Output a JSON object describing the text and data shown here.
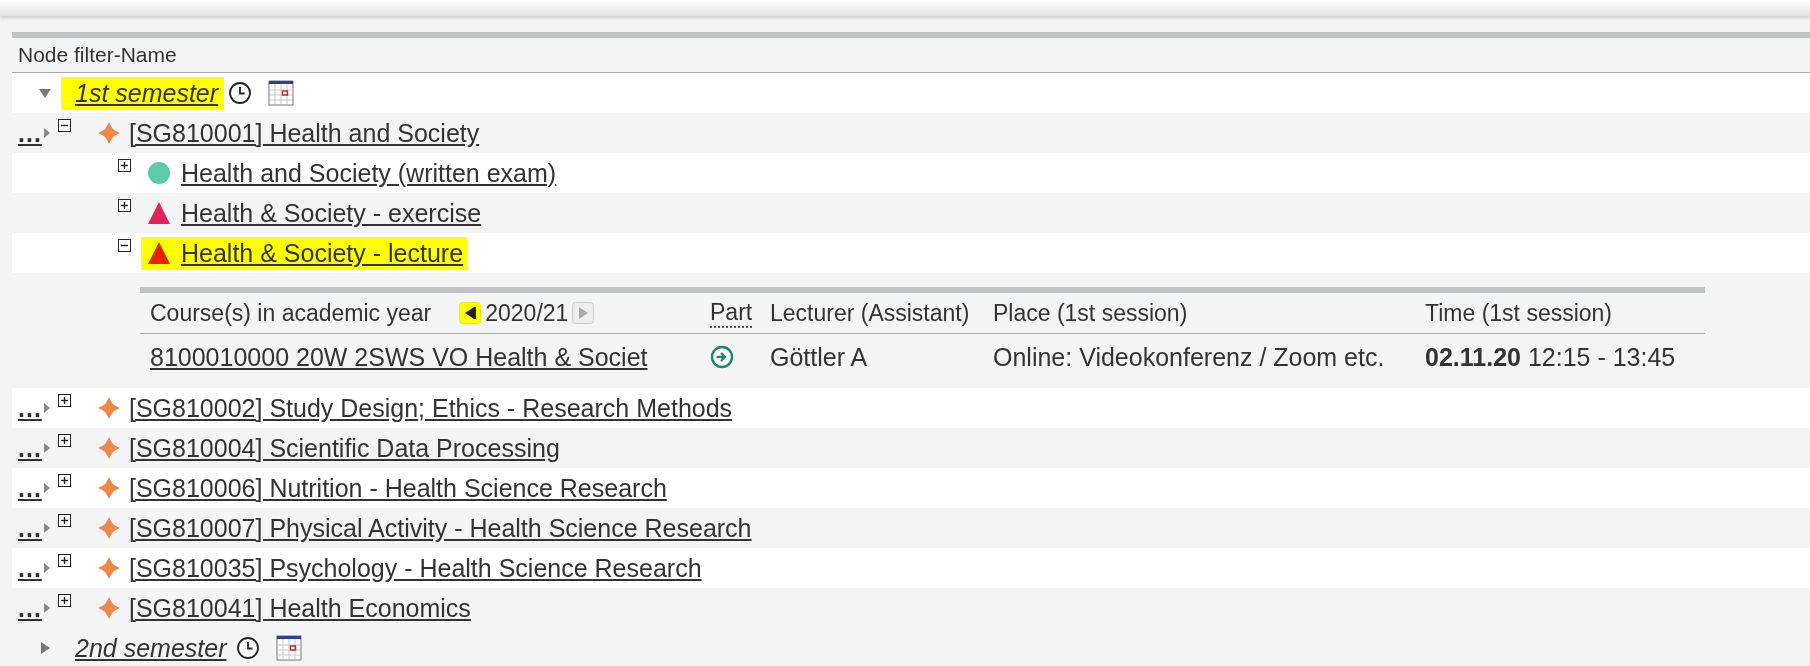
{
  "header": {
    "title": "Node filter-Name"
  },
  "semesters": [
    {
      "label": "1st semester",
      "expanded": true,
      "highlighted": true,
      "modules": [
        {
          "more": "...",
          "label": "[SG810001] Health and Society",
          "expanded": true,
          "children": [
            {
              "label": "Health and Society (written exam)",
              "kind": "circle",
              "color": "#5cc9a7",
              "expanded": false,
              "highlighted": false
            },
            {
              "label": "Health & Society - exercise",
              "kind": "triangle",
              "color": "#e0245e",
              "expanded": false,
              "highlighted": false
            },
            {
              "label": "Health & Society - lecture",
              "kind": "triangle",
              "color": "#e32400",
              "expanded": true,
              "highlighted": true,
              "courses": {
                "title": "Course(s) in academic year",
                "year": "2020/21",
                "prev_highlighted": true,
                "next_disabled": true,
                "columns": [
                  "Part",
                  "Lecturer (Assistant)",
                  "Place (1st session)",
                  "Time (1st session)"
                ],
                "rows": [
                  {
                    "course": "8100010000 20W 2SWS VO Health & Societ",
                    "lecturer": "Göttler A",
                    "place": "Online: Videokonferenz / Zoom etc.",
                    "date": "02.11.20",
                    "time": "12:15 - 13:45"
                  }
                ]
              }
            }
          ]
        },
        {
          "more": "...",
          "label": "[SG810002] Study Design; Ethics - Research Methods",
          "expanded": false
        },
        {
          "more": "...",
          "label": "[SG810004] Scientific Data Processing",
          "expanded": false
        },
        {
          "more": "...",
          "label": "[SG810006] Nutrition - Health Science Research",
          "expanded": false
        },
        {
          "more": "...",
          "label": "[SG810007] Physical Activity - Health Science Research",
          "expanded": false
        },
        {
          "more": "...",
          "label": "[SG810035] Psychology - Health Science Research",
          "expanded": false
        },
        {
          "more": "...",
          "label": "[SG810041] Health Economics",
          "expanded": false
        }
      ]
    },
    {
      "label": "2nd semester",
      "expanded": false,
      "highlighted": false
    }
  ]
}
